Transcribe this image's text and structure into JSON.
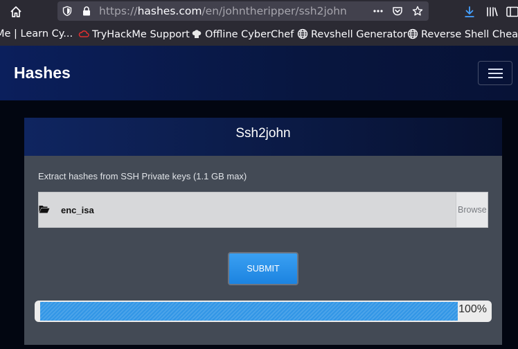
{
  "browser": {
    "url_prefix": "https://",
    "url_host": "hashes.com",
    "url_path": "/en/johntheripper/ssh2john"
  },
  "bookmarks": [
    {
      "label": "Me | Learn Cy...",
      "icon": "page-icon"
    },
    {
      "label": "TryHackMe Support",
      "icon": "cloud-icon"
    },
    {
      "label": "Offline CyberChef",
      "icon": "chef-hat-icon"
    },
    {
      "label": "Revshell Generator",
      "icon": "globe-icon"
    },
    {
      "label": "Reverse Shell Cheat S",
      "icon": "globe-icon"
    }
  ],
  "navbar": {
    "brand": "Hashes"
  },
  "card": {
    "title": "Ssh2john",
    "description": "Extract hashes from SSH Private keys (1.1 GB max)",
    "file_name": "enc_isa",
    "browse_label": "Browse",
    "submit_label": "SUBMIT",
    "progress_text": "100%",
    "progress_value": 1.0
  },
  "colors": {
    "accent": "#2a93eb",
    "card_body": "#434a55",
    "navbar": "#0b1f5c"
  }
}
